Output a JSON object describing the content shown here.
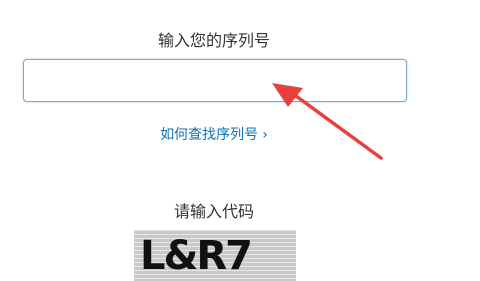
{
  "serial": {
    "label": "输入您的序列号",
    "value": "",
    "placeholder": ""
  },
  "find_link": {
    "text": "如何查找序列号",
    "chevron": "›"
  },
  "code": {
    "label": "请输入代码",
    "captcha_text": "L&R7"
  },
  "colors": {
    "link": "#0c72b5",
    "input_border": "#7aa7d4",
    "arrow": "#e8403d"
  },
  "icons": {
    "annotation": "red-arrow-icon",
    "link_chevron": "chevron-right-icon"
  }
}
